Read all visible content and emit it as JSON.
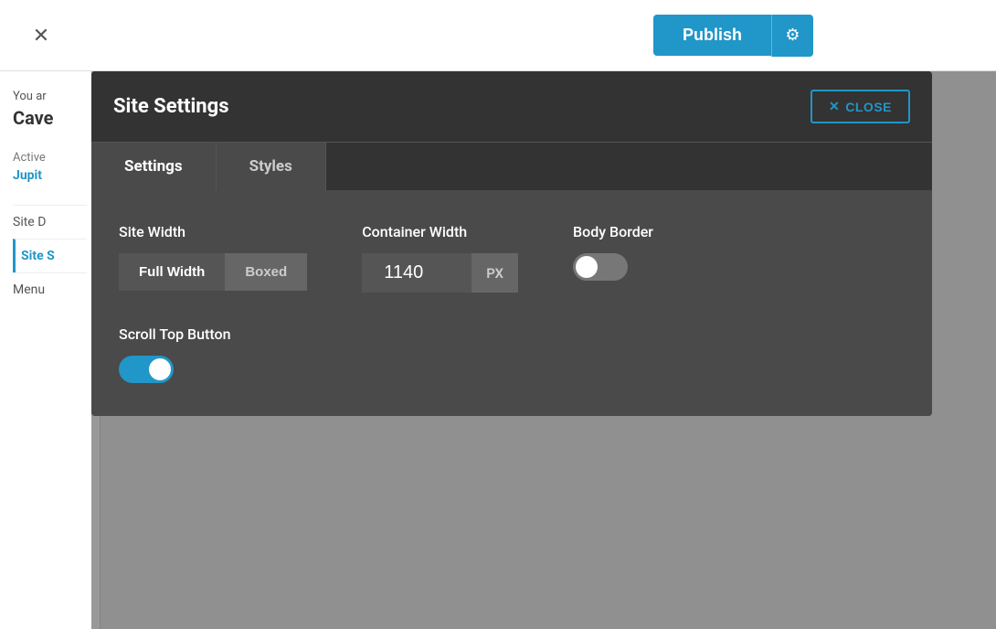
{
  "topbar": {
    "close_label": "✕",
    "publish_label": "Publish",
    "publish_settings_icon": "gear-icon"
  },
  "sidebar": {
    "you_are_text": "You ar",
    "site_title": "Cave",
    "active_label": "Active",
    "active_value": "Jupit",
    "items": [
      {
        "label": "Site D",
        "active": false
      },
      {
        "label": "Site S",
        "active": true
      },
      {
        "label": "Menu",
        "active": false
      }
    ]
  },
  "modal": {
    "title": "Site Settings",
    "close_label": "CLOSE",
    "close_icon": "✕",
    "tabs": [
      {
        "label": "Settings",
        "active": true
      },
      {
        "label": "Styles",
        "active": false
      }
    ],
    "settings": {
      "site_width_label": "Site Width",
      "full_width_label": "Full Width",
      "boxed_label": "Boxed",
      "container_width_label": "Container Width",
      "container_width_value": "1140",
      "container_width_unit": "PX",
      "body_border_label": "Body Border",
      "body_border_enabled": false,
      "scroll_top_button_label": "Scroll Top Button",
      "scroll_top_enabled": true
    }
  }
}
